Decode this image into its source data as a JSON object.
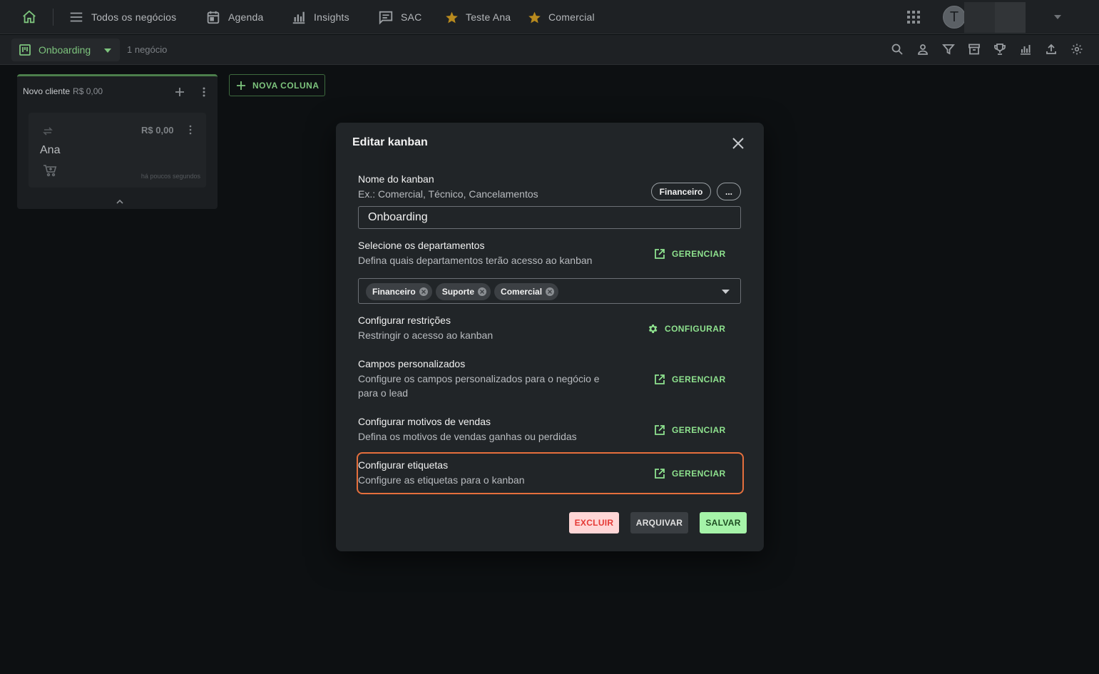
{
  "topbar": {
    "nav": [
      {
        "label": "Todos os negócios",
        "icon": "menu-icon"
      },
      {
        "label": "Agenda",
        "icon": "calendar-icon"
      },
      {
        "label": "Insights",
        "icon": "bar-chart-icon"
      },
      {
        "label": "SAC",
        "icon": "chat-icon"
      },
      {
        "label": "Teste Ana",
        "icon": "star-icon"
      },
      {
        "label": "Comercial",
        "icon": "star-icon"
      }
    ],
    "avatar_initial": "T"
  },
  "subbar": {
    "kanban_name": "Onboarding",
    "deal_count": "1 negócio"
  },
  "board": {
    "column": {
      "title": "Novo cliente",
      "amount": "R$ 0,00"
    },
    "card": {
      "price": "R$ 0,00",
      "name": "Ana",
      "timestamp": "há poucos segundos"
    },
    "new_column_label": "NOVA COLUNA"
  },
  "modal": {
    "title": "Editar kanban",
    "name_section": {
      "title": "Nome do kanban",
      "description": "Ex.: Comercial, Técnico, Cancelamentos",
      "suggestions": [
        "Financeiro",
        "..."
      ],
      "value": "Onboarding"
    },
    "departments": {
      "title": "Selecione os departamentos",
      "description": "Defina quais departamentos terão acesso ao kanban",
      "action": "GERENCIAR",
      "chips": [
        "Financeiro",
        "Suporte",
        "Comercial"
      ]
    },
    "restrictions": {
      "title": "Configurar restrições",
      "description": "Restringir o acesso ao kanban",
      "action": "CONFIGURAR"
    },
    "custom_fields": {
      "title": "Campos personalizados",
      "description": "Configure os campos personalizados para o negócio e para o lead",
      "action": "GERENCIAR"
    },
    "sales_reasons": {
      "title": "Configurar motivos de vendas",
      "description": "Defina os motivos de vendas ganhas ou perdidas",
      "action": "GERENCIAR"
    },
    "tags": {
      "title": "Configurar etiquetas",
      "description": "Configure as etiquetas para o kanban",
      "action": "GERENCIAR"
    },
    "buttons": {
      "delete": "EXCLUIR",
      "archive": "ARQUIVAR",
      "save": "SALVAR"
    }
  },
  "colors": {
    "accent_green": "#8ee28e",
    "highlight_orange": "#e56f3d",
    "delete_bg": "#ffd6d6",
    "delete_text": "#e53935",
    "save_bg": "#a5f3a8"
  }
}
